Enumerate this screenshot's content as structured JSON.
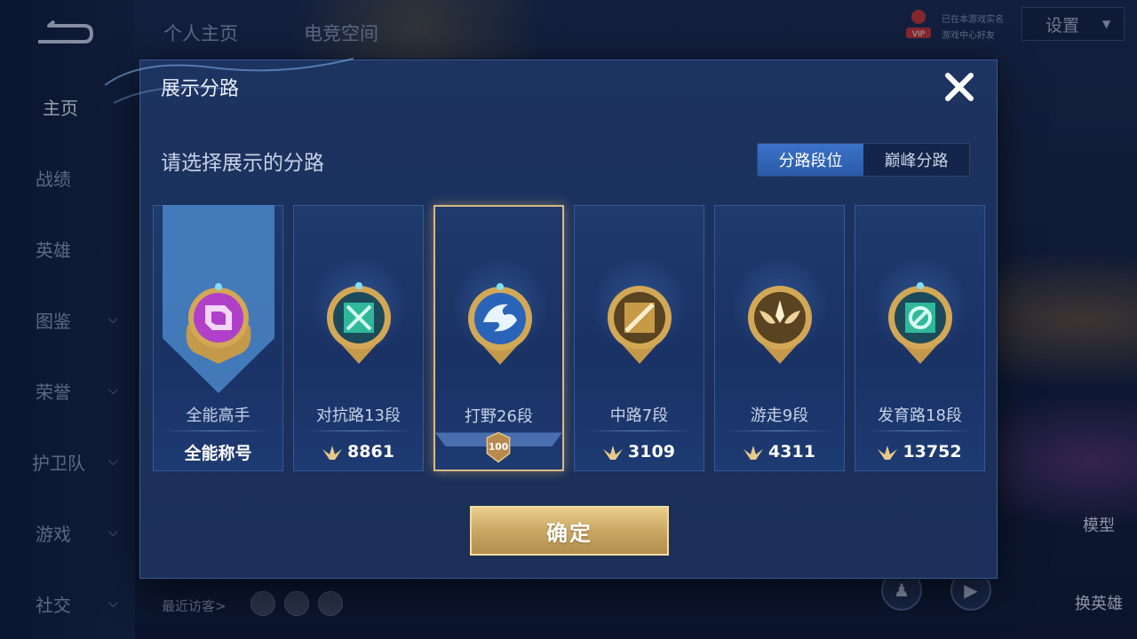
{
  "sidebar": {
    "items": [
      {
        "label": "主页",
        "has_chevron": false,
        "active": true
      },
      {
        "label": "战绩",
        "has_chevron": false
      },
      {
        "label": "英雄",
        "has_chevron": false
      },
      {
        "label": "图鉴",
        "has_chevron": true
      },
      {
        "label": "荣誉",
        "has_chevron": true
      },
      {
        "label": "护卫队",
        "has_chevron": true
      },
      {
        "label": "游戏",
        "has_chevron": true
      },
      {
        "label": "社交",
        "has_chevron": true
      }
    ]
  },
  "top": {
    "tabs": [
      "个人主页",
      "电竞空间"
    ],
    "vip_label": "VIP",
    "vip_lines": [
      "已在本游戏实名",
      "游戏中心好友"
    ],
    "settings_label": "设置"
  },
  "bottom": {
    "recent_visitors": "最近访客>",
    "model_label": "模型",
    "switch_hero_label": "换英雄"
  },
  "modal": {
    "title": "展示分路",
    "subtitle": "请选择展示的分路",
    "toggle": {
      "selected": "分路段位",
      "other": "巅峰分路"
    },
    "cards": [
      {
        "name": "全能高手",
        "footer": "全能称号",
        "badge_color": "#b040c8",
        "type": "banner"
      },
      {
        "name": "对抗路13段",
        "points": "8861",
        "badge_color": "#2fb89a"
      },
      {
        "name": "打野26段",
        "level": "100",
        "badge_color": "#3a7fd6",
        "selected": true
      },
      {
        "name": "中路7段",
        "points": "3109",
        "badge_color": "#c79a48"
      },
      {
        "name": "游走9段",
        "points": "4311",
        "badge_color": "#c79a48"
      },
      {
        "name": "发育路18段",
        "points": "13752",
        "badge_color": "#2fb89a"
      }
    ],
    "confirm_label": "确定"
  },
  "colors": {
    "gold": "#d8b883",
    "toggle_on": "#3b72c8",
    "panel": "#1d3360"
  }
}
